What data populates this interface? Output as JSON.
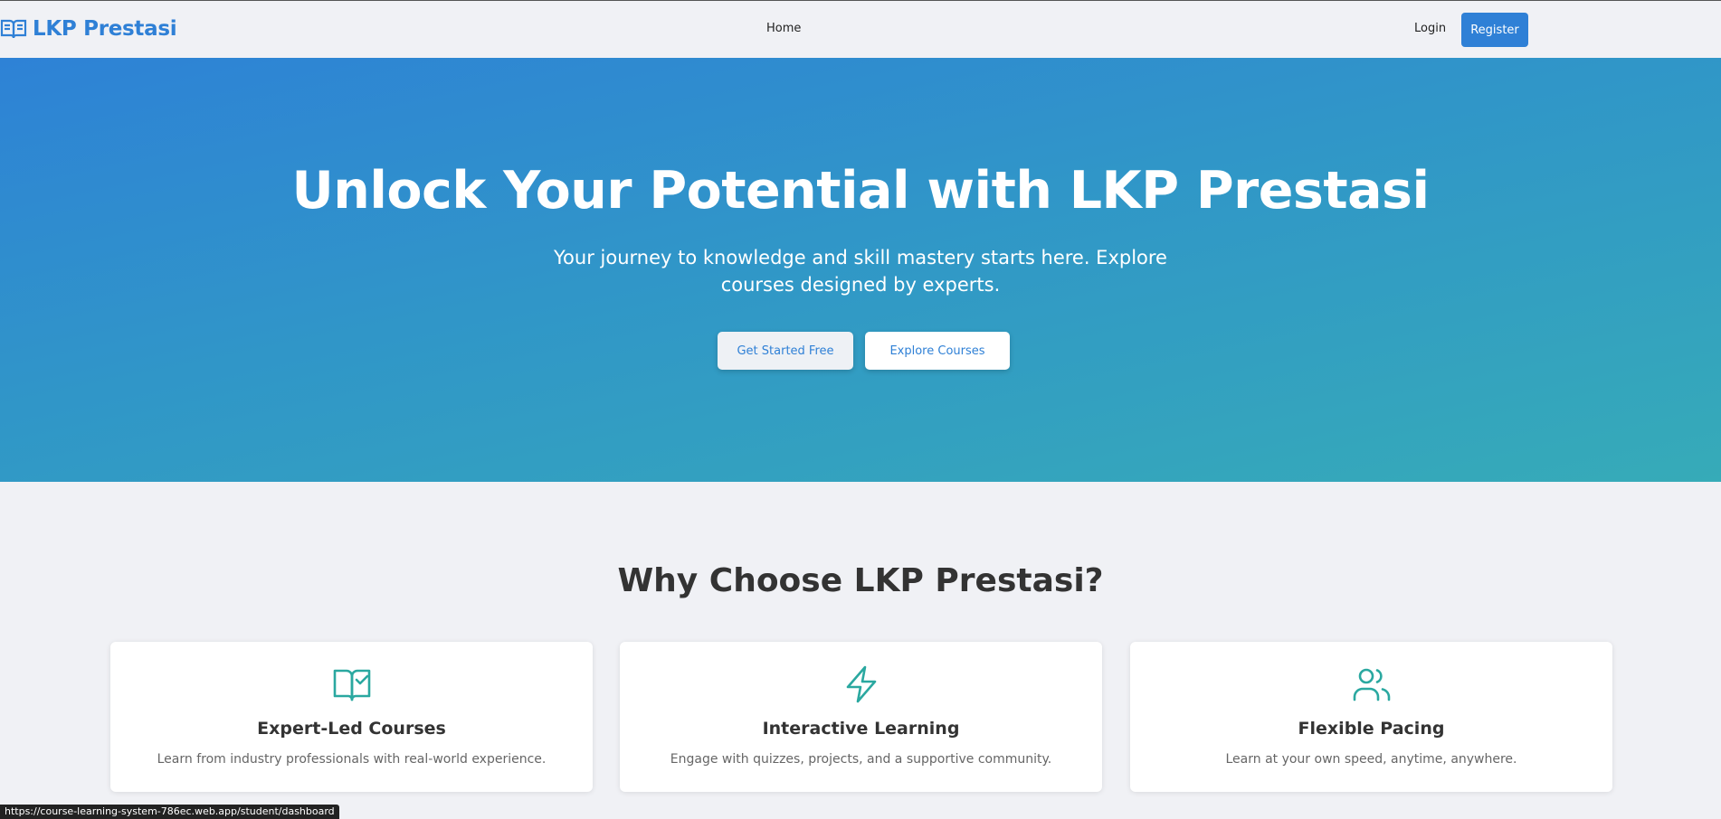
{
  "header": {
    "brand": "LKP Prestasi",
    "nav_home": "Home",
    "login": "Login",
    "register": "Register"
  },
  "hero": {
    "title": "Unlock Your Potential with LKP Prestasi",
    "subtitle": "Your journey to knowledge and skill mastery starts here. Explore courses designed by experts.",
    "primary_button": "Get Started Free",
    "secondary_button": "Explore Courses"
  },
  "features": {
    "title": "Why Choose LKP Prestasi?",
    "cards": [
      {
        "icon": "book-check-icon",
        "title": "Expert-Led Courses",
        "desc": "Learn from industry professionals with real-world experience."
      },
      {
        "icon": "lightning-icon",
        "title": "Interactive Learning",
        "desc": "Engage with quizzes, projects, and a supportive community."
      },
      {
        "icon": "users-icon",
        "title": "Flexible Pacing",
        "desc": "Learn at your own speed, anytime, anywhere."
      }
    ]
  },
  "status_bar": {
    "url": "https://course-learning-system-786ec.web.app/student/dashboard"
  },
  "colors": {
    "brand": "#2f80d6",
    "accent_teal": "#2aa8a0",
    "hero_start": "#2e82d6",
    "hero_end": "#36abb8"
  }
}
